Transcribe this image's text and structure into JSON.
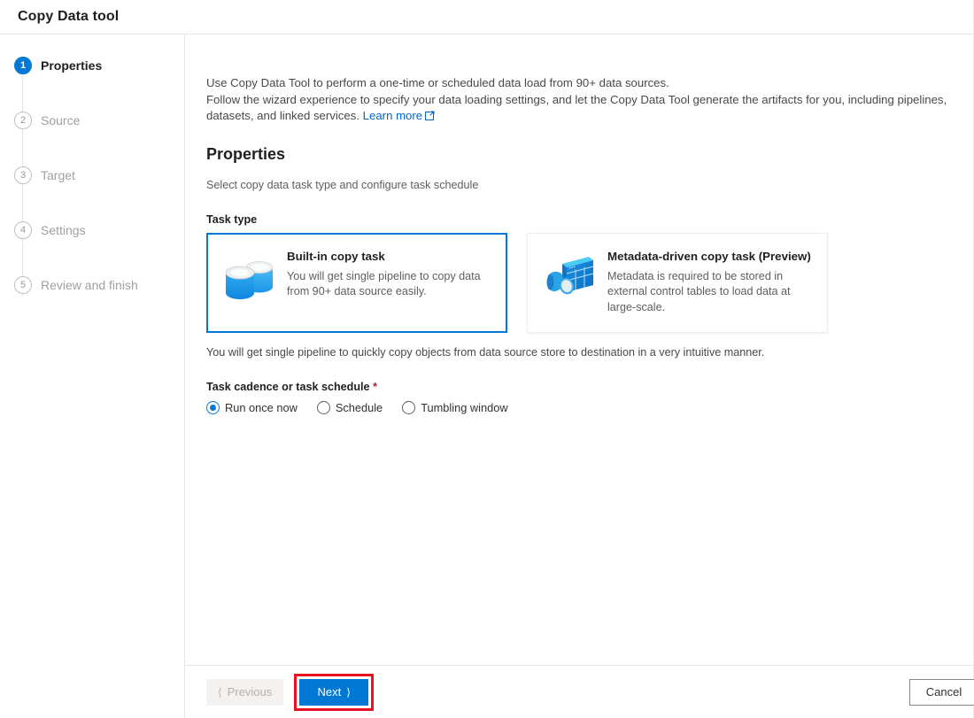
{
  "window": {
    "title": "Copy Data tool"
  },
  "sidebar": {
    "steps": [
      {
        "num": "1",
        "label": "Properties",
        "state": "active"
      },
      {
        "num": "2",
        "label": "Source",
        "state": "inactive"
      },
      {
        "num": "3",
        "label": "Target",
        "state": "inactive"
      },
      {
        "num": "4",
        "label": "Settings",
        "state": "inactive"
      },
      {
        "num": "5",
        "label": "Review and finish",
        "state": "inactive"
      }
    ]
  },
  "intro": {
    "line1": "Use Copy Data Tool to perform a one-time or scheduled data load from 90+ data sources.",
    "line2": "Follow the wizard experience to specify your data loading settings, and let the Copy Data Tool generate the artifacts for you, including pipelines, datasets, and linked services.",
    "link_label": "Learn more"
  },
  "section": {
    "title": "Properties",
    "subtitle": "Select copy data task type and configure task schedule"
  },
  "task_type": {
    "label": "Task type",
    "cards": [
      {
        "title": "Built-in copy task",
        "desc": "You will get single pipeline to copy data from 90+ data source easily.",
        "icon": "database-copy-icon",
        "selected": true
      },
      {
        "title": "Metadata-driven copy task (Preview)",
        "desc": "Metadata is required to be stored in external control tables to load data at large-scale.",
        "icon": "metadata-table-icon",
        "selected": false
      }
    ],
    "note": "You will get single pipeline to quickly copy objects from data source store to destination in a very intuitive manner."
  },
  "cadence": {
    "label": "Task cadence or task schedule",
    "required_marker": "*",
    "options": [
      {
        "label": "Run once now",
        "checked": true
      },
      {
        "label": "Schedule",
        "checked": false
      },
      {
        "label": "Tumbling window",
        "checked": false
      }
    ]
  },
  "footer": {
    "previous_label": "Previous",
    "next_label": "Next",
    "cancel_label": "Cancel",
    "next_highlighted": true
  },
  "colors": {
    "accent": "#0078d4",
    "highlight": "#e81123",
    "required": "#a4262c"
  }
}
